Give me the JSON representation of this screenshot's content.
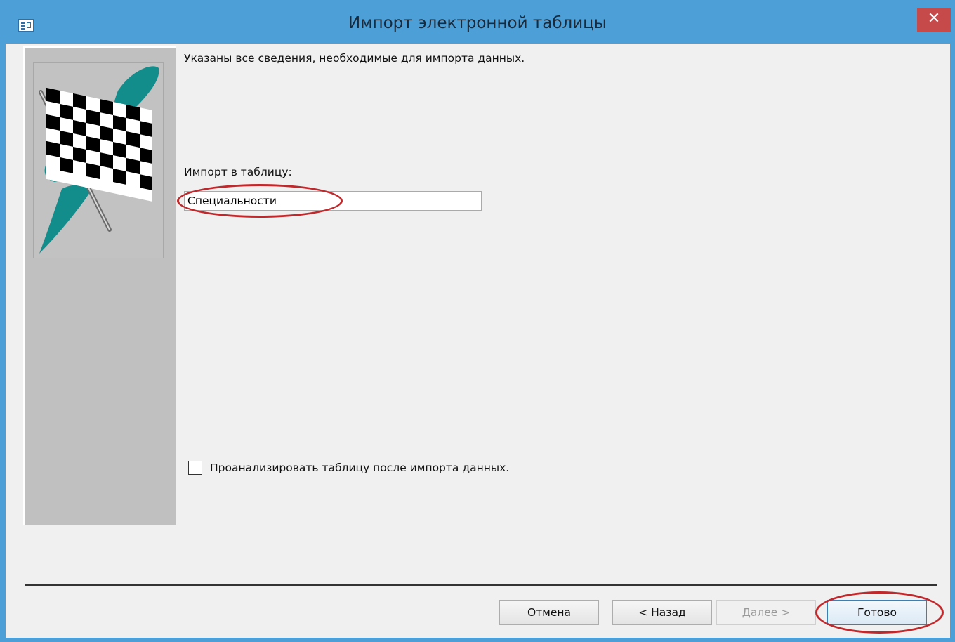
{
  "window": {
    "title": "Импорт электронной таблицы",
    "close_glyph": "✕"
  },
  "content": {
    "info_text": "Указаны все сведения, необходимые для импорта данных.",
    "import_to_label": "Импорт в таблицу:",
    "import_to_value": "Специальности",
    "analyze_checkbox_label": "Проанализировать таблицу после импорта данных.",
    "analyze_checked": false
  },
  "buttons": {
    "cancel": "Отмена",
    "back": "< Назад",
    "next": "Далее >",
    "finish": "Готово"
  },
  "colors": {
    "titlebar": "#4d9fd8",
    "close": "#c74a4a",
    "highlight": "#c0282b",
    "flag_teal": "#138c8c"
  },
  "icons": {
    "app": "access-table-icon",
    "side_image": "checkered-flag-icon"
  }
}
